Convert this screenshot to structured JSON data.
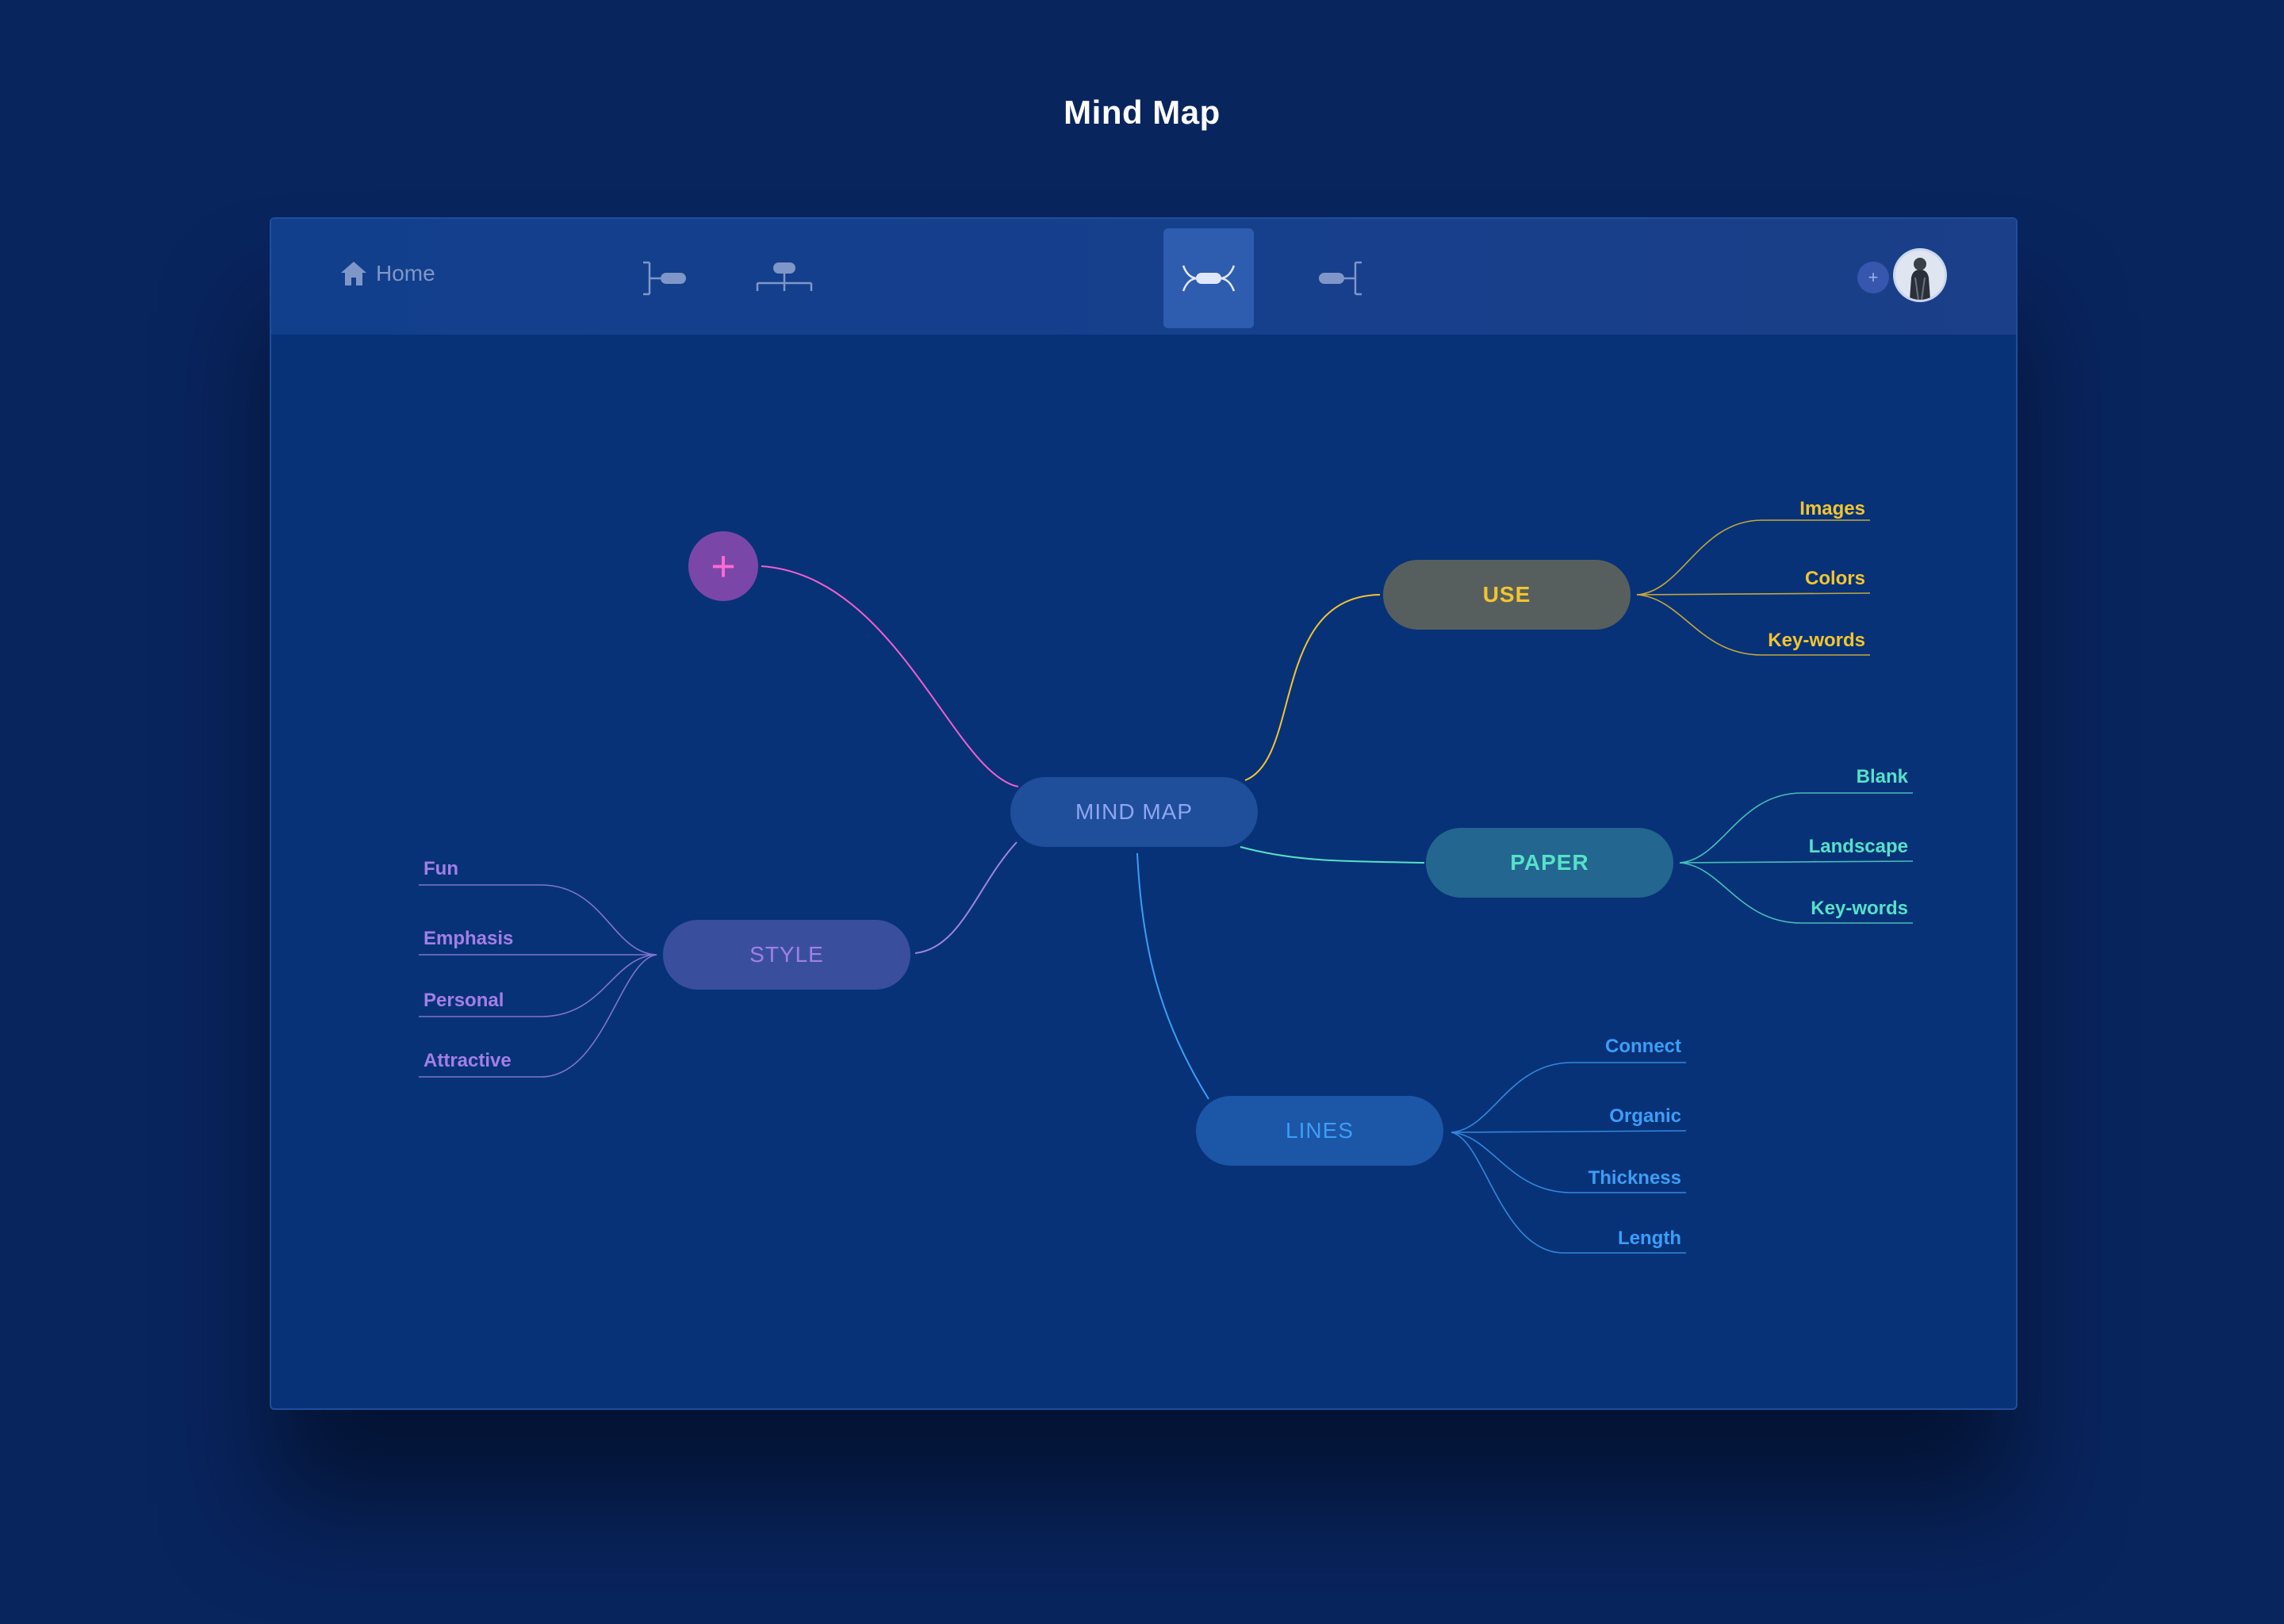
{
  "page": {
    "title": "Mind Map"
  },
  "toolbar": {
    "home_label": "Home",
    "layouts": [
      {
        "icon": "right-tree-layout-icon",
        "active": false
      },
      {
        "icon": "org-chart-layout-icon",
        "active": false
      },
      {
        "icon": "mind-map-layout-icon",
        "active": true
      },
      {
        "icon": "left-tree-layout-icon",
        "active": false
      }
    ],
    "add_collaborator_label": "+"
  },
  "map": {
    "central": {
      "label": "MIND MAP"
    },
    "add_node_label": "+",
    "branches": {
      "use": {
        "label": "USE",
        "color": "#f2c530",
        "children": [
          "Images",
          "Colors",
          "Key-words"
        ]
      },
      "paper": {
        "label": "PAPER",
        "color": "#55e1c9",
        "children": [
          "Blank",
          "Landscape",
          "Key-words"
        ]
      },
      "lines": {
        "label": "LINES",
        "color": "#3d9df6",
        "children": [
          "Connect",
          "Organic",
          "Thickness",
          "Length"
        ]
      },
      "style": {
        "label": "STYLE",
        "color": "#a27fe6",
        "children": [
          "Fun",
          "Emphasis",
          "Personal",
          "Attractive"
        ]
      }
    }
  }
}
